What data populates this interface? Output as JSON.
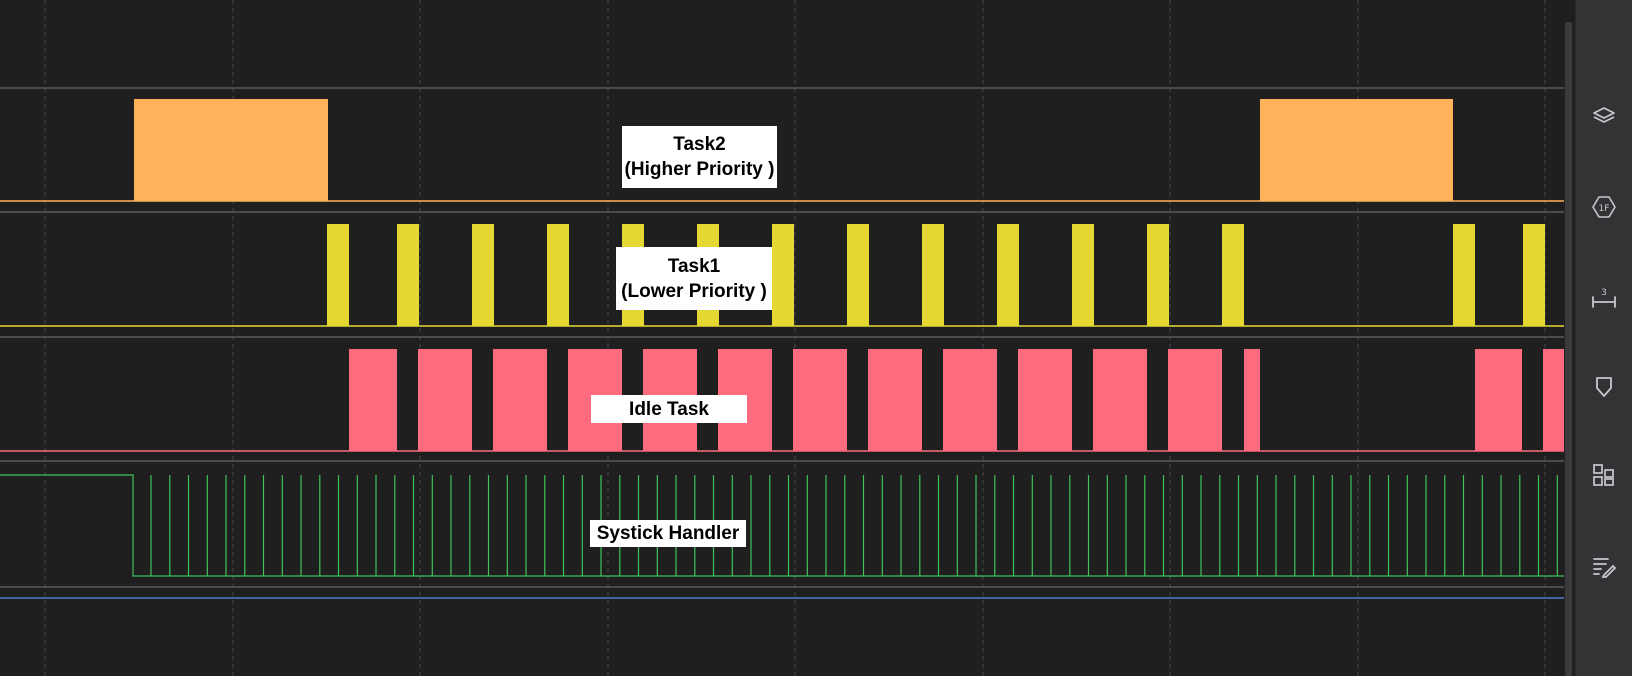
{
  "waveforms": {
    "labels": {
      "task2_line1": "Task2",
      "task2_line2": "(Higher Priority )",
      "task1_line1": "Task1",
      "task1_line2": "(Lower Priority )",
      "idle": "Idle Task",
      "systick": "Systick Handler"
    },
    "colors": {
      "background": "#1f1f1f",
      "separator": "#5a5a5c",
      "grid": "#4a4a4c",
      "task2": "#ffb25a",
      "task1": "#e6d832",
      "idle": "#ff6b7f",
      "systick": "#3fc25a",
      "bottom_line": "#4d7ed1"
    }
  },
  "sidebar": {
    "icons": [
      {
        "name": "layers-icon"
      },
      {
        "name": "hex-badge-icon",
        "text": "1F"
      },
      {
        "name": "ruler-icon",
        "text": "3"
      },
      {
        "name": "marker-icon"
      },
      {
        "name": "grid-layout-icon"
      },
      {
        "name": "edit-list-icon"
      }
    ]
  }
}
